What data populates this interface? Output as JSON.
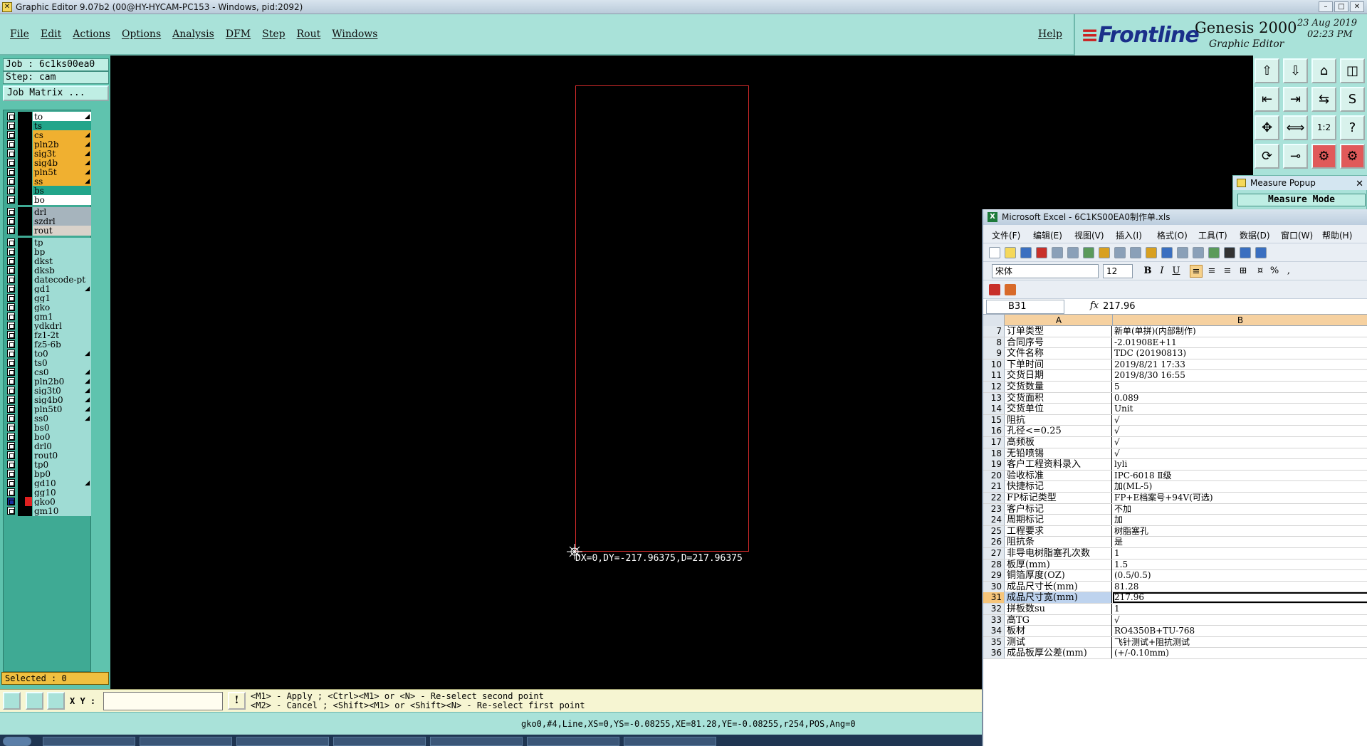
{
  "window": {
    "title": "Graphic Editor 9.07b2 (00@HY-HYCAM-PC153 - Windows, pid:2092)"
  },
  "menu": {
    "items": [
      "File",
      "Edit",
      "Actions",
      "Options",
      "Analysis",
      "DFM",
      "Step",
      "Rout",
      "Windows"
    ],
    "help": "Help"
  },
  "brand": {
    "logo": "Frontline",
    "product": "Genesis 2000",
    "subtitle": "Graphic Editor",
    "date": "23 Aug 2019",
    "time": "02:23 PM"
  },
  "job": {
    "job_label": "Job : 6c1ks00ea0",
    "step_label": "Step: cam",
    "matrix_button": "Job Matrix ..."
  },
  "layers": [
    {
      "name": "to",
      "color": "#ffffff",
      "arrow": true
    },
    {
      "name": "ts",
      "color": "#22a58a",
      "arrow": false
    },
    {
      "name": "cs",
      "color": "#f0b030",
      "arrow": true
    },
    {
      "name": "pln2b",
      "color": "#f0b030",
      "arrow": true
    },
    {
      "name": "sig3t",
      "color": "#f0b030",
      "arrow": true
    },
    {
      "name": "sig4b",
      "color": "#f0b030",
      "arrow": true
    },
    {
      "name": "pln5t",
      "color": "#f0b030",
      "arrow": true
    },
    {
      "name": "ss",
      "color": "#f0b030",
      "arrow": true
    },
    {
      "name": "bs",
      "color": "#22a58a",
      "arrow": false
    },
    {
      "name": "bo",
      "color": "#ffffff",
      "arrow": false
    },
    {
      "name": "drl",
      "color": "#a6b4bd",
      "arrow": false,
      "gap": true
    },
    {
      "name": "szdrl",
      "color": "#a6b4bd",
      "arrow": false
    },
    {
      "name": "rout",
      "color": "#d9d2ca",
      "arrow": false
    },
    {
      "name": "tp",
      "color": "#9fdcd4",
      "arrow": false,
      "gap": true
    },
    {
      "name": "bp",
      "color": "#9fdcd4",
      "arrow": false
    },
    {
      "name": "dkst",
      "color": "#9fdcd4",
      "arrow": false
    },
    {
      "name": "dksb",
      "color": "#9fdcd4",
      "arrow": false
    },
    {
      "name": "datecode-pt",
      "color": "#9fdcd4",
      "arrow": false
    },
    {
      "name": "gd1",
      "color": "#9fdcd4",
      "arrow": true
    },
    {
      "name": "gg1",
      "color": "#9fdcd4",
      "arrow": false
    },
    {
      "name": "gko",
      "color": "#9fdcd4",
      "arrow": false
    },
    {
      "name": "gm1",
      "color": "#9fdcd4",
      "arrow": false
    },
    {
      "name": "ydkdrl",
      "color": "#9fdcd4",
      "arrow": false
    },
    {
      "name": "fz1-2t",
      "color": "#9fdcd4",
      "arrow": false
    },
    {
      "name": "fz5-6b",
      "color": "#9fdcd4",
      "arrow": false
    },
    {
      "name": "to0",
      "color": "#9fdcd4",
      "arrow": true
    },
    {
      "name": "ts0",
      "color": "#9fdcd4",
      "arrow": false
    },
    {
      "name": "cs0",
      "color": "#9fdcd4",
      "arrow": true
    },
    {
      "name": "pln2b0",
      "color": "#9fdcd4",
      "arrow": true
    },
    {
      "name": "sig3t0",
      "color": "#9fdcd4",
      "arrow": true
    },
    {
      "name": "sig4b0",
      "color": "#9fdcd4",
      "arrow": true
    },
    {
      "name": "pln5t0",
      "color": "#9fdcd4",
      "arrow": true
    },
    {
      "name": "ss0",
      "color": "#9fdcd4",
      "arrow": true
    },
    {
      "name": "bs0",
      "color": "#9fdcd4",
      "arrow": false
    },
    {
      "name": "bo0",
      "color": "#9fdcd4",
      "arrow": false
    },
    {
      "name": "drl0",
      "color": "#9fdcd4",
      "arrow": false
    },
    {
      "name": "rout0",
      "color": "#9fdcd4",
      "arrow": false
    },
    {
      "name": "tp0",
      "color": "#9fdcd4",
      "arrow": false
    },
    {
      "name": "bp0",
      "color": "#9fdcd4",
      "arrow": false
    },
    {
      "name": "gd10",
      "color": "#9fdcd4",
      "arrow": true
    },
    {
      "name": "gg10",
      "color": "#9fdcd4",
      "arrow": false
    },
    {
      "name": "gko0",
      "color": "#9fdcd4",
      "arrow": false,
      "active": true
    },
    {
      "name": "gm10",
      "color": "#9fdcd4",
      "arrow": false
    }
  ],
  "selected_label": "Selected : 0",
  "canvas": {
    "board_color": "#d02a2a",
    "measure_readout": "DX=0,DY=-217.96375,D=217.96375"
  },
  "toolbar_icons": [
    "open-job-icon",
    "save-icon",
    "home-icon",
    "split-view-icon",
    "step-left-icon",
    "step-right-icon",
    "snap-icon",
    "route-icon",
    "zoom-fit-icon",
    "pan-icon",
    "scale-icon",
    "help-icon",
    "layer-compare-icon",
    "measure-icon",
    "net-highlight-icon",
    "net-compare-icon"
  ],
  "measure_popup": {
    "title": "Measure Popup",
    "mode": "Measure Mode"
  },
  "bottom": {
    "xy_label": "X Y :",
    "xy_value": "",
    "hint1": "<M1> - Apply  ; <Ctrl><M1> or <N> - Re-select second point",
    "hint2": "<M2> - Cancel ; <Shift><M1> or <Shift><N> - Re-select first point",
    "status": "gko0,#4,Line,XS=0,YS=-0.08255,XE=81.28,YE=-0.08255,r254,POS,Ang=0"
  },
  "excel": {
    "title": "Microsoft Excel - 6C1KS00EA0制作单.xls",
    "menu": [
      "文件(F)",
      "编辑(E)",
      "视图(V)",
      "插入(I)",
      "格式(O)",
      "工具(T)",
      "数据(D)",
      "窗口(W)",
      "帮助(H)"
    ],
    "font": "宋体",
    "size": "12",
    "bold": "B",
    "italic": "I",
    "underline": "U",
    "name_box": "B31",
    "fx": "fx",
    "formula": "217.96",
    "col_a": "A",
    "col_b": "B",
    "rows": [
      {
        "n": "7",
        "a": "订单类型",
        "b": "新单(单拼)(内部制作)"
      },
      {
        "n": "8",
        "a": "合同序号",
        "b": "-2.01908E+11"
      },
      {
        "n": "9",
        "a": "文件名称",
        "b": "TDC (20190813)"
      },
      {
        "n": "10",
        "a": "下单时间",
        "b": "2019/8/21 17:33"
      },
      {
        "n": "11",
        "a": "交货日期",
        "b": "2019/8/30 16:55"
      },
      {
        "n": "12",
        "a": "交货数量",
        "b": "5"
      },
      {
        "n": "13",
        "a": "交货面积",
        "b": "0.089"
      },
      {
        "n": "14",
        "a": "交货单位",
        "b": "Unit"
      },
      {
        "n": "15",
        "a": "阻抗",
        "b": "√"
      },
      {
        "n": "16",
        "a": "孔径<=0.25",
        "b": "√"
      },
      {
        "n": "17",
        "a": "高频板",
        "b": "√"
      },
      {
        "n": "18",
        "a": "无铅喷锡",
        "b": "√"
      },
      {
        "n": "19",
        "a": "客户工程资料录入",
        "b": "lyli"
      },
      {
        "n": "20",
        "a": "验收标准",
        "b": "IPC-6018 Ⅱ级"
      },
      {
        "n": "21",
        "a": "快捷标记",
        "b": "加(ML-5)"
      },
      {
        "n": "22",
        "a": "FP标记类型",
        "b": "FP+E档案号+94V(可选)"
      },
      {
        "n": "23",
        "a": "客户标记",
        "b": "不加"
      },
      {
        "n": "24",
        "a": "周期标记",
        "b": "加"
      },
      {
        "n": "25",
        "a": "工程要求",
        "b": "树脂塞孔"
      },
      {
        "n": "26",
        "a": "阻抗条",
        "b": "是"
      },
      {
        "n": "27",
        "a": "非导电树脂塞孔次数",
        "b": "1"
      },
      {
        "n": "28",
        "a": "板厚(mm)",
        "b": "1.5"
      },
      {
        "n": "29",
        "a": "铜箔厚度(OZ)",
        "b": "(0.5/0.5)"
      },
      {
        "n": "30",
        "a": "成品尺寸长(mm)",
        "b": "81.28"
      },
      {
        "n": "31",
        "a": "成品尺寸宽(mm)",
        "b": "217.96",
        "selected": true
      },
      {
        "n": "32",
        "a": "拼板数su",
        "b": "1"
      },
      {
        "n": "33",
        "a": "高TG",
        "b": "√"
      },
      {
        "n": "34",
        "a": "板材",
        "b": "RO4350B+TU-768"
      },
      {
        "n": "35",
        "a": "测试",
        "b": "飞针测试+阻抗测试"
      },
      {
        "n": "36",
        "a": "成品板厚公差(mm)",
        "b": "(+/-0.10mm)"
      }
    ]
  }
}
